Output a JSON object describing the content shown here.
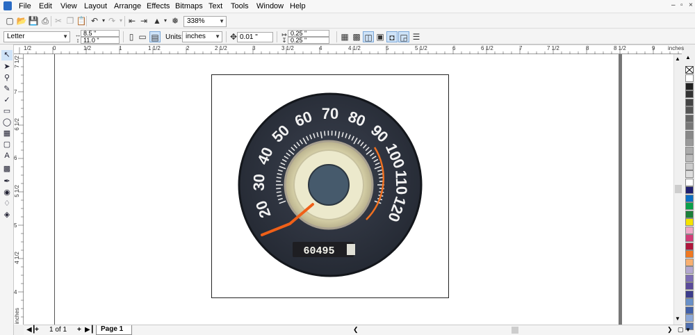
{
  "menu": [
    "File",
    "Edit",
    "View",
    "Layout",
    "Arrange",
    "Effects",
    "Bitmaps",
    "Text",
    "Tools",
    "Window",
    "Help"
  ],
  "window_controls": [
    "–",
    "▫",
    "×"
  ],
  "toolbar": {
    "zoom": "338%"
  },
  "property_bar": {
    "paper_preset": "Letter",
    "width": "8.5 \"",
    "height": "11.0 \"",
    "units_label": "Units:",
    "units_value": "inches",
    "nudge": "0.01 \"",
    "dup_x": "0.25 \"",
    "dup_y": "0.25 \""
  },
  "hruler_ticks": [
    "1/2",
    "0",
    "1/2",
    "1",
    "1 1/2",
    "2",
    "2 1/2",
    "3",
    "3 1/2",
    "4",
    "4 1/2",
    "5",
    "5 1/2",
    "6",
    "6 1/2",
    "7",
    "7 1/2",
    "8",
    "8 1/2",
    "9",
    "inches"
  ],
  "vruler_ticks": [
    "7 1/2",
    "7",
    "6 1/2",
    "6",
    "5 1/2",
    "5",
    "4 1/2",
    "4",
    "inches"
  ],
  "speedometer": {
    "dial_numbers": [
      "20",
      "30",
      "40",
      "50",
      "60",
      "70",
      "80",
      "90",
      "100",
      "110",
      "120"
    ],
    "odometer": "60495"
  },
  "status": {
    "page_count": "1 of 1",
    "page_tab": "Page 1"
  },
  "palette": [
    "#ffffff",
    "#222222",
    "#333333",
    "#444444",
    "#555555",
    "#666666",
    "#777777",
    "#888888",
    "#999999",
    "#aaaaaa",
    "#bbbbbb",
    "#cccccc",
    "#dddddd",
    "#ffffff",
    "#1f1f6f",
    "#0b6fc4",
    "#0aa04a",
    "#1a7f3a",
    "#f5e400",
    "#f0a8c8",
    "#d23c78",
    "#b0163c",
    "#f07820",
    "#f8b070",
    "#b4a8d0",
    "#7c6cb4",
    "#5a4a9a",
    "#3c3c8c",
    "#6890c8",
    "#405fa8",
    "#8ca8d8",
    "#5070b0"
  ]
}
